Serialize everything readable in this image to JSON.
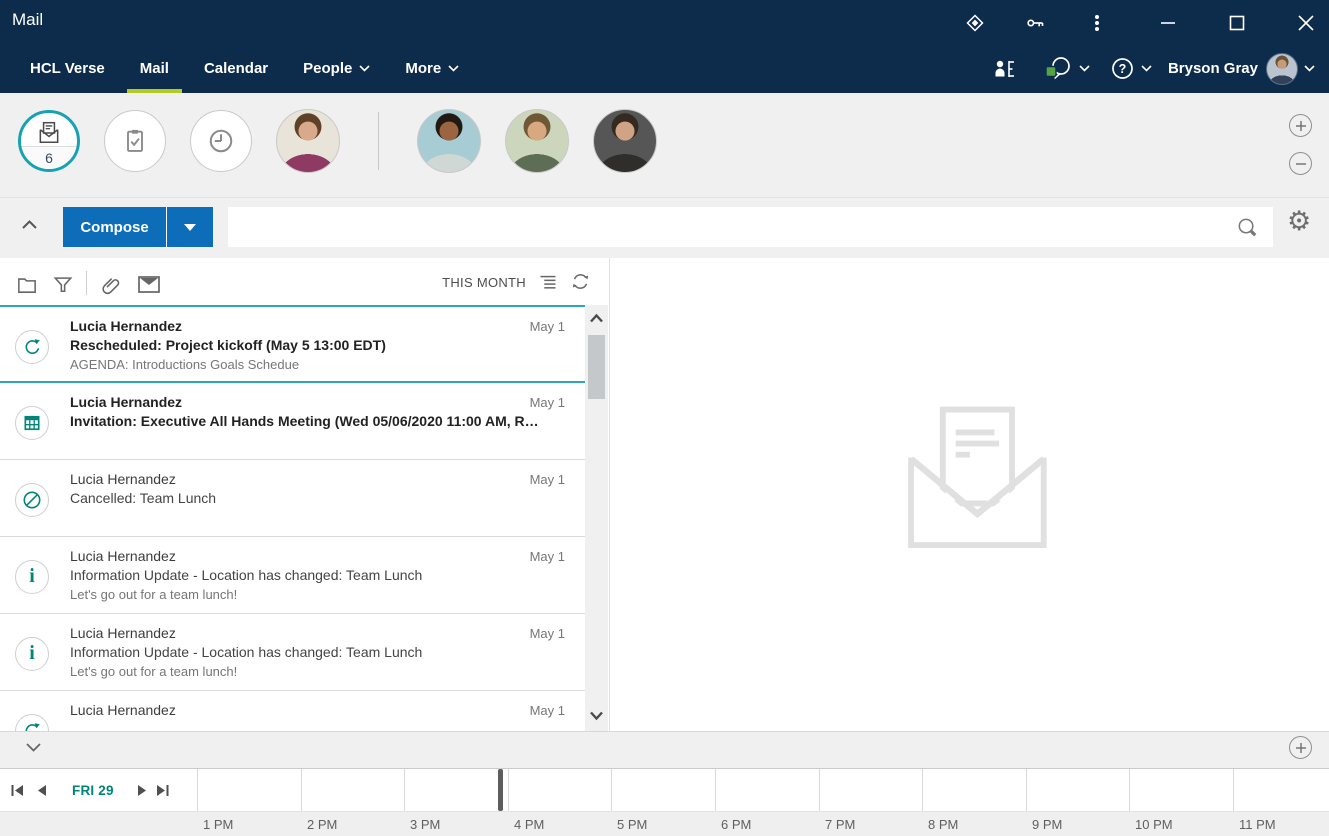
{
  "colors": {
    "header_navy": "#0d2c4c",
    "active_tab_underline": "#b6ca25",
    "inbox_ring_teal": "#16a2b2",
    "selected_item_teal": "#2ba7b5",
    "list_icon_teal": "#00857a",
    "compose_blue": "#0d6db9",
    "status_green": "#57a146"
  },
  "titlebar": {
    "title": "Mail",
    "icons": [
      "app-switcher",
      "key",
      "overflow-menu",
      "minimize",
      "maximize",
      "close"
    ]
  },
  "navbar": {
    "items": [
      {
        "id": "hcl-verse",
        "label": "HCL Verse",
        "active": false,
        "dropdown": false
      },
      {
        "id": "mail",
        "label": "Mail",
        "active": true,
        "dropdown": false
      },
      {
        "id": "calendar",
        "label": "Calendar",
        "active": false,
        "dropdown": false
      },
      {
        "id": "people",
        "label": "People",
        "active": false,
        "dropdown": true
      },
      {
        "id": "more",
        "label": "More",
        "active": false,
        "dropdown": true
      }
    ],
    "user_name": "Bryson Gray"
  },
  "people_bar": {
    "inbox_count": "6",
    "quick_circles": [
      "inbox",
      "to-do",
      "waiting-for"
    ],
    "pinned_avatars": [
      {
        "id": "pinned-person-1",
        "style": "av1"
      },
      {
        "id": "pinned-person-2",
        "style": "av2"
      },
      {
        "id": "pinned-person-3",
        "style": "av3"
      },
      {
        "id": "pinned-person-4",
        "style": "av4"
      }
    ]
  },
  "action_bar": {
    "compose_label": "Compose",
    "search_value": "",
    "search_placeholder": ""
  },
  "mail_list": {
    "range_label": "THIS MONTH",
    "toolbar_icons": [
      "folder",
      "filter",
      "attachment",
      "envelope"
    ],
    "items": [
      {
        "icon": "refresh",
        "sender": "Lucia Hernandez",
        "subject": "Rescheduled: Project kickoff (May 5 13:00 EDT)",
        "preview": "AGENDA: Introductions Goals Schedue",
        "date": "May 1",
        "unread": true,
        "selected": true
      },
      {
        "icon": "calendar",
        "sender": "Lucia Hernandez",
        "subject": "Invitation: Executive All Hands Meeting (Wed 05/06/2020 11:00 AM, R…",
        "preview": "",
        "date": "May 1",
        "unread": true,
        "selected": false
      },
      {
        "icon": "cancelled",
        "sender": "Lucia Hernandez",
        "subject": "Cancelled: Team Lunch",
        "preview": "",
        "date": "May 1",
        "unread": false,
        "selected": false
      },
      {
        "icon": "info",
        "sender": "Lucia Hernandez",
        "subject": "Information Update - Location has changed: Team Lunch",
        "preview": "Let's go out for a team lunch!",
        "date": "May 1",
        "unread": false,
        "selected": false
      },
      {
        "icon": "info",
        "sender": "Lucia Hernandez",
        "subject": "Information Update - Location has changed: Team Lunch",
        "preview": "Let's go out for a team lunch!",
        "date": "May 1",
        "unread": false,
        "selected": false
      },
      {
        "icon": "refresh",
        "sender": "Lucia Hernandez",
        "subject": "",
        "preview": "",
        "date": "May 1",
        "unread": false,
        "selected": false
      }
    ]
  },
  "reading_pane": {
    "empty_state_icon": "open-envelope"
  },
  "timeline": {
    "date_label": "FRI 29",
    "hours": [
      "1 PM",
      "2 PM",
      "3 PM",
      "4 PM",
      "5 PM",
      "6 PM",
      "7 PM",
      "8 PM",
      "9 PM",
      "10 PM",
      "11 PM"
    ],
    "now_marker": true
  }
}
